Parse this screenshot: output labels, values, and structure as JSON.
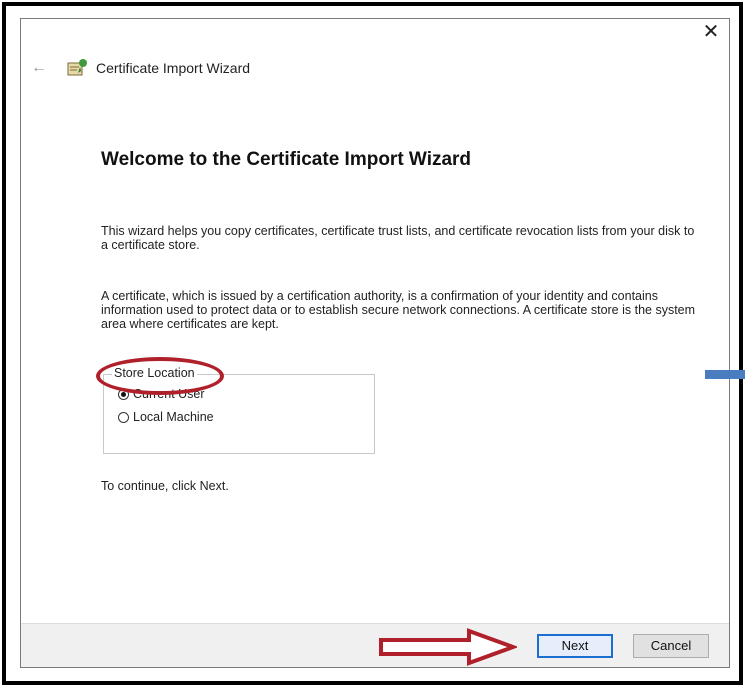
{
  "window": {
    "title": "Certificate Import Wizard",
    "close_glyph": "✕",
    "back_glyph": "←"
  },
  "content": {
    "heading": "Welcome to the Certificate Import Wizard",
    "paragraph1": "This wizard helps you copy certificates, certificate trust lists, and certificate revocation lists from your disk to a certificate store.",
    "paragraph2": "A certificate, which is issued by a certification authority, is a confirmation of your identity and contains information used to protect data or to establish secure network connections. A certificate store is the system area where certificates are kept.",
    "store_location": {
      "legend": "Store Location",
      "options": [
        {
          "label": "Current User",
          "selected": true
        },
        {
          "label": "Local Machine",
          "selected": false
        }
      ]
    },
    "continue_text": "To continue, click Next."
  },
  "footer": {
    "next_label": "Next",
    "cancel_label": "Cancel"
  },
  "colors": {
    "highlight_ellipse": "#b0202a",
    "annotation_arrow": "#b0202a",
    "default_button_border": "#1c6fd1",
    "side_marker": "#4a7cc0"
  },
  "icons": {
    "title": "certificate-wizard-icon",
    "back": "back-arrow-icon",
    "close": "close-icon"
  }
}
